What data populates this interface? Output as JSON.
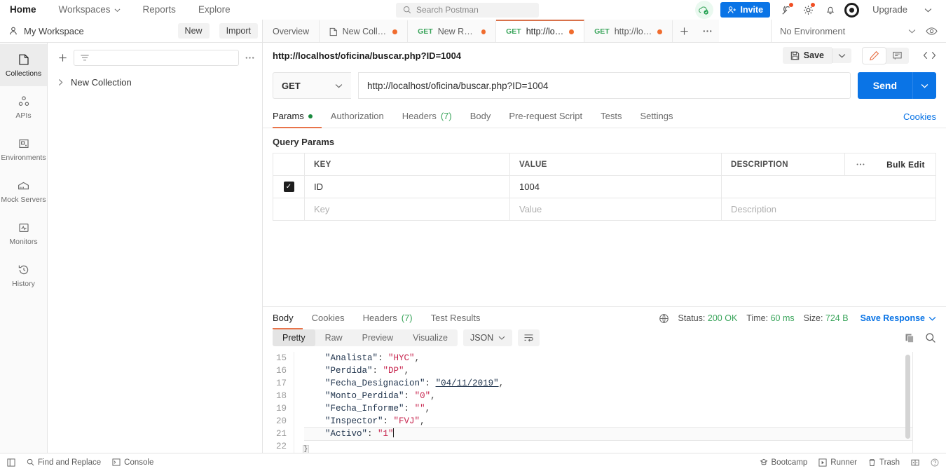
{
  "topbar": {
    "nav": [
      {
        "label": "Home",
        "active": true,
        "caret": false
      },
      {
        "label": "Workspaces",
        "active": false,
        "caret": true
      },
      {
        "label": "Reports",
        "active": false,
        "caret": false
      },
      {
        "label": "Explore",
        "active": false,
        "caret": false
      }
    ],
    "search_placeholder": "Search Postman",
    "invite_label": "Invite",
    "upgrade_label": "Upgrade",
    "icons": [
      "cloud-check-icon",
      "invite-icon",
      "broadcast-icon",
      "gear-icon",
      "bell-icon",
      "avatar-icon"
    ]
  },
  "workspace": {
    "name": "My Workspace",
    "new_label": "New",
    "import_label": "Import",
    "environment_selected": "No Environment"
  },
  "tabs": [
    {
      "label": "Overview",
      "method": "",
      "dirty": false,
      "active": false,
      "icon": ""
    },
    {
      "label": "New Colle...",
      "method": "",
      "dirty": true,
      "active": false,
      "icon": "collection-icon"
    },
    {
      "label": "New Req...",
      "method": "GET",
      "dirty": true,
      "active": false,
      "icon": ""
    },
    {
      "label": "http://loc...",
      "method": "GET",
      "dirty": true,
      "active": true,
      "icon": ""
    },
    {
      "label": "http://loc...",
      "method": "GET",
      "dirty": true,
      "active": false,
      "icon": ""
    }
  ],
  "rail": [
    {
      "label": "Collections",
      "icon": "collections-icon",
      "active": true
    },
    {
      "label": "APIs",
      "icon": "apis-icon",
      "active": false
    },
    {
      "label": "Environments",
      "icon": "environments-icon",
      "active": false
    },
    {
      "label": "Mock Servers",
      "icon": "mock-servers-icon",
      "active": false
    },
    {
      "label": "Monitors",
      "icon": "monitors-icon",
      "active": false
    },
    {
      "label": "History",
      "icon": "history-icon",
      "active": false
    }
  ],
  "sidebar": {
    "filter_placeholder": "",
    "items": [
      {
        "label": "New Collection"
      }
    ]
  },
  "request": {
    "title": "http://localhost/oficina/buscar.php?ID=1004",
    "save_label": "Save",
    "method": "GET",
    "url": "http://localhost/oficina/buscar.php?ID=1004",
    "send_label": "Send",
    "tabs": [
      {
        "label": "Params",
        "active": true,
        "dot": true,
        "count": ""
      },
      {
        "label": "Authorization",
        "active": false,
        "dot": false,
        "count": ""
      },
      {
        "label": "Headers",
        "active": false,
        "dot": false,
        "count": "(7)"
      },
      {
        "label": "Body",
        "active": false,
        "dot": false,
        "count": ""
      },
      {
        "label": "Pre-request Script",
        "active": false,
        "dot": false,
        "count": ""
      },
      {
        "label": "Tests",
        "active": false,
        "dot": false,
        "count": ""
      },
      {
        "label": "Settings",
        "active": false,
        "dot": false,
        "count": ""
      }
    ],
    "cookies_label": "Cookies",
    "query_params_label": "Query Params",
    "table": {
      "headers": {
        "key": "KEY",
        "value": "VALUE",
        "description": "DESCRIPTION"
      },
      "bulk_edit_label": "Bulk Edit",
      "rows": [
        {
          "checked": true,
          "key": "ID",
          "value": "1004",
          "description": ""
        }
      ],
      "placeholder_row": {
        "key": "Key",
        "value": "Value",
        "description": "Description"
      }
    }
  },
  "response": {
    "tabs": [
      {
        "label": "Body",
        "active": true,
        "count": ""
      },
      {
        "label": "Cookies",
        "active": false,
        "count": ""
      },
      {
        "label": "Headers",
        "active": false,
        "count": "(7)"
      },
      {
        "label": "Test Results",
        "active": false,
        "count": ""
      }
    ],
    "status_label": "Status:",
    "status_value": "200 OK",
    "time_label": "Time:",
    "time_value": "60 ms",
    "size_label": "Size:",
    "size_value": "724 B",
    "save_response_label": "Save Response",
    "format_tabs": [
      {
        "label": "Pretty",
        "active": true
      },
      {
        "label": "Raw",
        "active": false
      },
      {
        "label": "Preview",
        "active": false
      },
      {
        "label": "Visualize",
        "active": false
      }
    ],
    "language": "JSON",
    "code_lines": [
      {
        "n": "15",
        "indent": 2,
        "key": "\"Analista\"",
        "value": "\"HYC\"",
        "comma": ",",
        "highlight": false
      },
      {
        "n": "16",
        "indent": 2,
        "key": "\"Perdida\"",
        "value": "\"DP\"",
        "comma": ",",
        "highlight": false
      },
      {
        "n": "17",
        "indent": 2,
        "key": "\"Fecha_Designacion\"",
        "value": "\"04/11/2019\"",
        "comma": ",",
        "highlight": false,
        "linked": true
      },
      {
        "n": "18",
        "indent": 2,
        "key": "\"Monto_Perdida\"",
        "value": "\"0\"",
        "comma": ",",
        "highlight": false
      },
      {
        "n": "19",
        "indent": 2,
        "key": "\"Fecha_Informe\"",
        "value": "\"\"",
        "comma": ",",
        "highlight": false
      },
      {
        "n": "20",
        "indent": 2,
        "key": "\"Inspector\"",
        "value": "\"FVJ\"",
        "comma": ",",
        "highlight": false
      },
      {
        "n": "21",
        "indent": 2,
        "key": "\"Activo\"",
        "value": "\"1\"",
        "comma": "",
        "highlight": true,
        "caret": true
      },
      {
        "n": "22",
        "indent": 0,
        "key": "",
        "value": "",
        "comma": "",
        "brace": "}",
        "highlight": false
      }
    ]
  },
  "statusbar": {
    "left": [
      {
        "label": "Find and Replace",
        "icon": "search-icon"
      },
      {
        "label": "Console",
        "icon": "console-icon"
      }
    ],
    "right": [
      {
        "label": "Bootcamp",
        "icon": "bootcamp-icon"
      },
      {
        "label": "Runner",
        "icon": "runner-icon"
      },
      {
        "label": "Trash",
        "icon": "trash-icon"
      }
    ]
  },
  "colors": {
    "accent_blue": "#0a74e6",
    "tab_orange": "#d8714a",
    "dirty_dot": "#f06c2e",
    "method_green": "#3ba55c",
    "json_key": "#20344d",
    "json_string": "#c7254e"
  }
}
